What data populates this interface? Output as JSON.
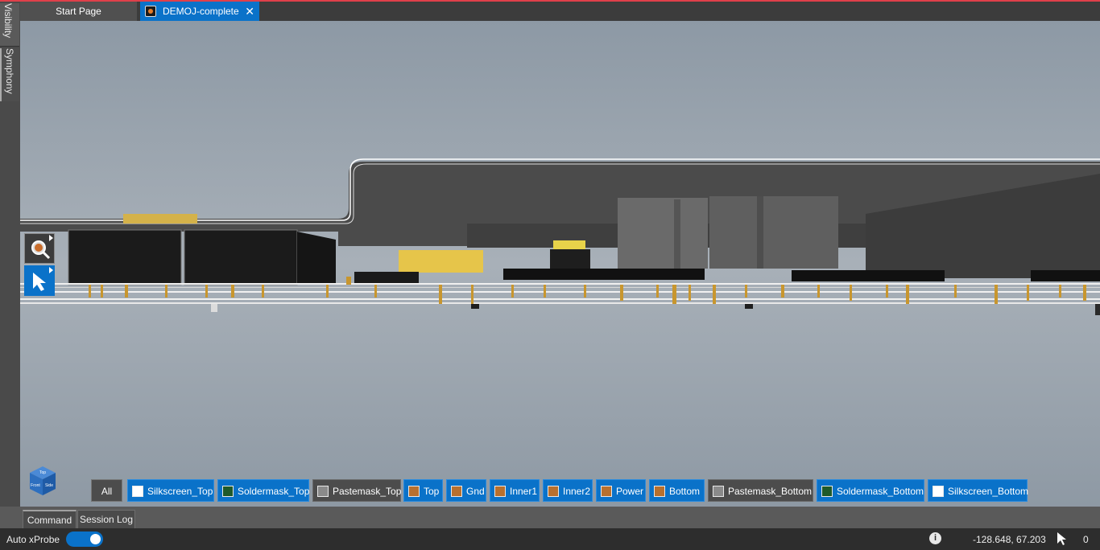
{
  "side_panel": {
    "tabs": [
      {
        "label": "Visibility"
      },
      {
        "label": "Symphony"
      }
    ]
  },
  "document_tabs": [
    {
      "label": "Start Page",
      "active": false
    },
    {
      "label": "DEMOJ-complete",
      "active": true,
      "icon": "pcb-document-icon",
      "close_icon": "close-icon"
    }
  ],
  "view_tools": [
    {
      "name": "zoom",
      "icon": "magnifier-icon"
    },
    {
      "name": "select",
      "icon": "pointer-arrow-icon",
      "active": true
    }
  ],
  "view_cube": {
    "faces": [
      "Top",
      "Front",
      "Side"
    ]
  },
  "layer_bar": {
    "all_label": "All",
    "layers": [
      {
        "label": "Silkscreen_Top",
        "swatch": "#ffffff",
        "enabled": true
      },
      {
        "label": "Soldermask_Top",
        "swatch": "#1f5a2a",
        "enabled": true
      },
      {
        "label": "Pastemask_Top",
        "swatch": "#8a8a8a",
        "enabled": false
      },
      {
        "label": "Top",
        "swatch": "#b8702e",
        "enabled": true
      },
      {
        "label": "Gnd",
        "swatch": "#b8702e",
        "enabled": true
      },
      {
        "label": "Inner1",
        "swatch": "#b8702e",
        "enabled": true
      },
      {
        "label": "Inner2",
        "swatch": "#b8702e",
        "enabled": true
      },
      {
        "label": "Power",
        "swatch": "#b8702e",
        "enabled": true
      },
      {
        "label": "Bottom",
        "swatch": "#b8702e",
        "enabled": true
      },
      {
        "label": "Pastemask_Bottom",
        "swatch": "#8a8a8a",
        "enabled": false
      },
      {
        "label": "Soldermask_Bottom",
        "swatch": "#1f5a2a",
        "enabled": true
      },
      {
        "label": "Silkscreen_Bottom",
        "swatch": "#ffffff",
        "enabled": true
      }
    ]
  },
  "bottom_tabs": [
    {
      "label": "Command",
      "active": true
    },
    {
      "label": "Session Log",
      "active": false
    }
  ],
  "status_bar": {
    "auto_xprobe_label": "Auto xProbe",
    "auto_xprobe_on": true,
    "info_icon": "info-icon",
    "coordinates": "-128.648, 67.203",
    "cursor_icon": "cursor-icon",
    "selection_count": "0"
  },
  "colors": {
    "accent": "#0a72c9",
    "top_line": "#e0404a",
    "copper": "#b8702e",
    "component_yellow": "#e6c54a"
  }
}
